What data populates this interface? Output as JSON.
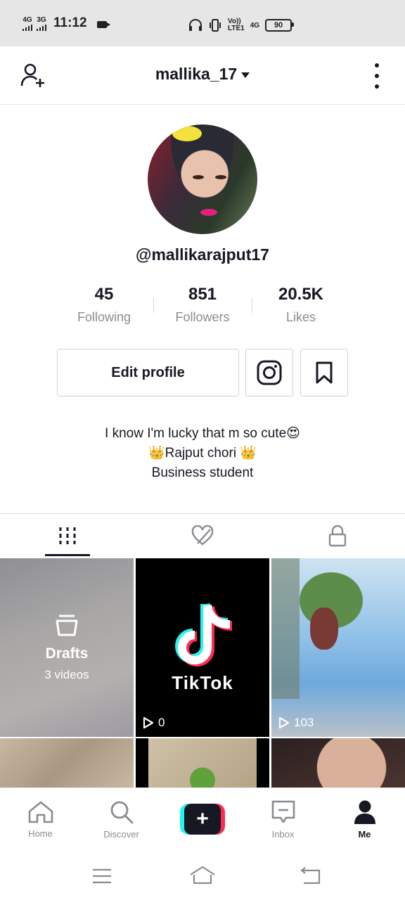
{
  "status_bar": {
    "net1": "4G",
    "net2": "3G",
    "time": "11:12",
    "volte": "Vo))",
    "lte": "LTE1",
    "net3": "4G",
    "battery": "90"
  },
  "header": {
    "username": "mallika_17"
  },
  "profile": {
    "handle": "@mallikarajput17",
    "stats": [
      {
        "value": "45",
        "label": "Following"
      },
      {
        "value": "851",
        "label": "Followers"
      },
      {
        "value": "20.5K",
        "label": "Likes"
      }
    ],
    "edit_label": "Edit profile",
    "bio": [
      "I know I'm lucky that m so cute😍",
      "👑Rajput chori 👑",
      "Business student"
    ]
  },
  "tabs": {
    "active_index": 0,
    "items": [
      {
        "icon": "grid-icon"
      },
      {
        "icon": "liked-hidden-icon"
      },
      {
        "icon": "lock-icon"
      }
    ]
  },
  "grid": {
    "drafts_label": "Drafts",
    "drafts_count": "3 videos",
    "tiktok_word": "TikTok",
    "views": [
      "0",
      "103"
    ]
  },
  "bottom_nav": {
    "items": [
      {
        "label": "Home",
        "icon": "home-icon"
      },
      {
        "label": "Discover",
        "icon": "search-icon"
      },
      {
        "label": "",
        "icon": "plus-icon"
      },
      {
        "label": "Inbox",
        "icon": "inbox-icon"
      },
      {
        "label": "Me",
        "icon": "person-icon"
      }
    ],
    "active": "Me"
  },
  "colors": {
    "text": "#161823",
    "muted": "#8a8b91",
    "cyan": "#25f4ee",
    "pink": "#fe2c55"
  }
}
